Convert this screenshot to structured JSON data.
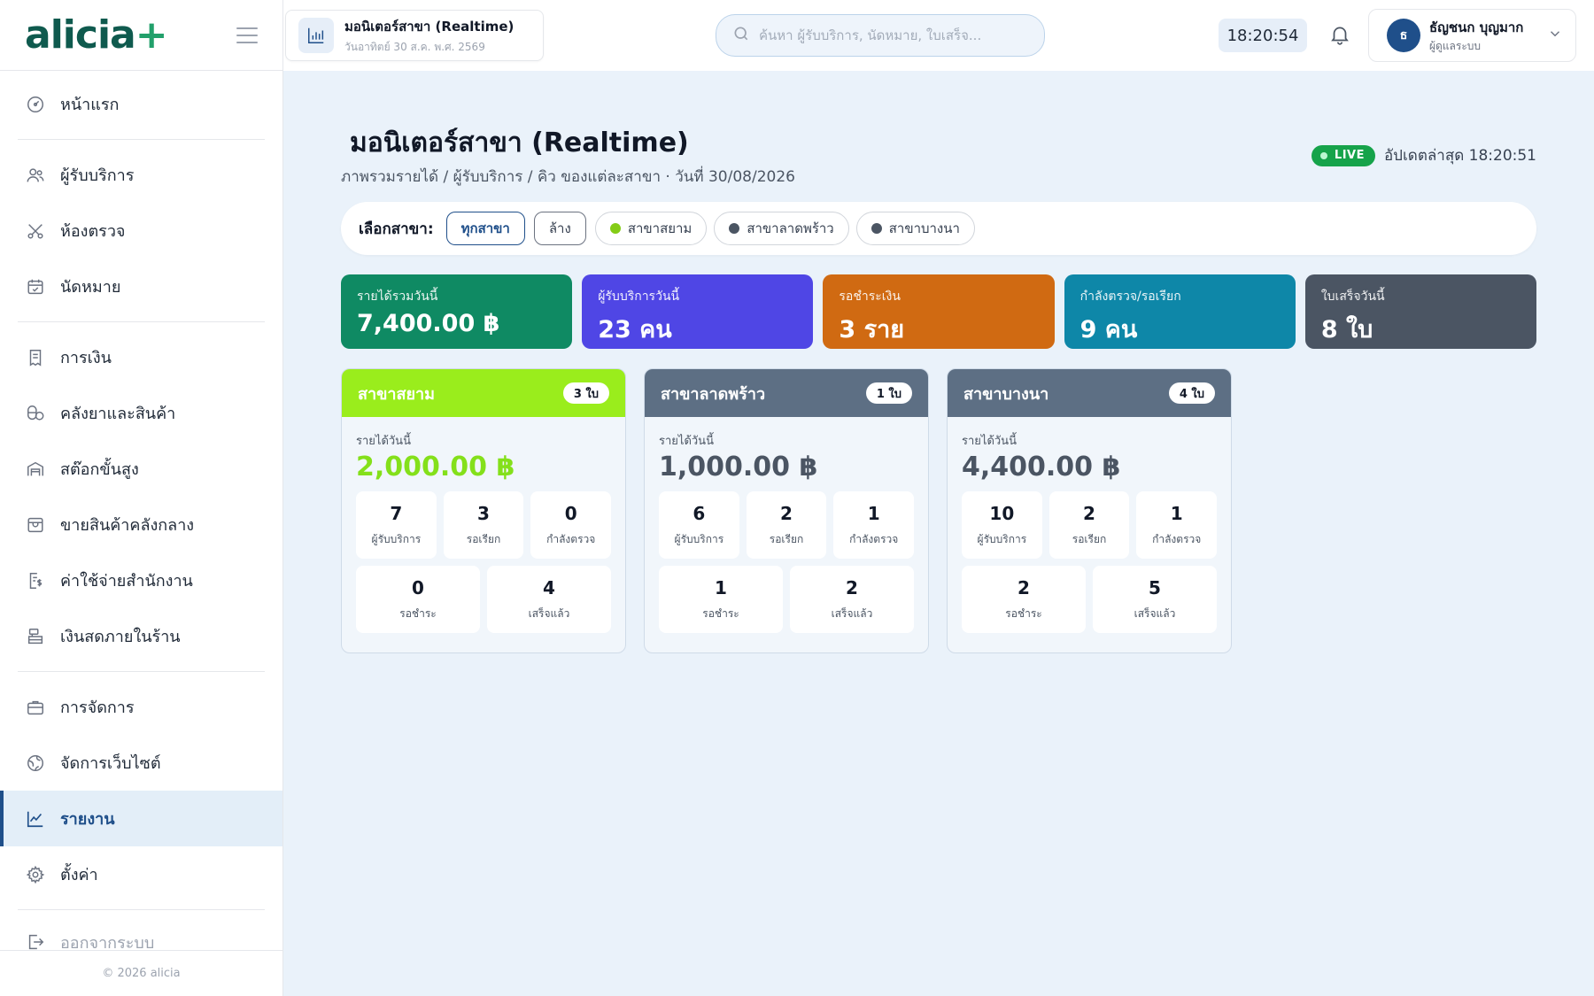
{
  "app": {
    "logo_main": "alicia",
    "logo_plus": "+"
  },
  "sidebar": {
    "items": [
      {
        "label": "หน้าแรก",
        "icon": "dashboard-icon"
      },
      {
        "label": "ผู้รับบริการ",
        "icon": "users-icon"
      },
      {
        "label": "ห้องตรวจ",
        "icon": "scissors-icon"
      },
      {
        "label": "นัดหมาย",
        "icon": "calendar-icon"
      },
      {
        "label": "การเงิน",
        "icon": "receipt-icon"
      },
      {
        "label": "คลังยาและสินค้า",
        "icon": "pills-icon"
      },
      {
        "label": "สต๊อกขั้นสูง",
        "icon": "warehouse-icon"
      },
      {
        "label": "ขายสินค้าคลังกลาง",
        "icon": "store-icon"
      },
      {
        "label": "ค่าใช้จ่ายสำนักงาน",
        "icon": "expense-icon"
      },
      {
        "label": "เงินสดภายในร้าน",
        "icon": "cash-register-icon"
      },
      {
        "label": "การจัดการ",
        "icon": "briefcase-icon"
      },
      {
        "label": "จัดการเว็บไซต์",
        "icon": "globe-icon"
      },
      {
        "label": "รายงาน",
        "icon": "chart-line-icon"
      },
      {
        "label": "ตั้งค่า",
        "icon": "gear-icon"
      },
      {
        "label": "ออกจากระบบ",
        "icon": "logout-icon"
      }
    ],
    "footer": "© 2026 alicia"
  },
  "topbar": {
    "page_title": "มอนิเตอร์สาขา (Realtime)",
    "page_date": "วันอาทิตย์ 30 ส.ค. พ.ศ. 2569",
    "search_placeholder": "ค้นหา ผู้รับบริการ, นัดหมาย, ใบเสร็จ...",
    "clock": "18:20:54",
    "user_initial": "ธ",
    "user_name": "ธัญชนก บุญมาก",
    "user_role": "ผู้ดูแลระบบ"
  },
  "main": {
    "title": "มอนิเตอร์สาขา (Realtime)",
    "subtitle": "ภาพรวมรายได้ / ผู้รับบริการ / คิว ของแต่ละสาขา · วันที่ 30/08/2026",
    "live_label": "LIVE",
    "updated": "อัปเดตล่าสุด 18:20:51"
  },
  "filter": {
    "label": "เลือกสาขา:",
    "all": "ทุกสาขา",
    "clear": "ล้าง",
    "branches": [
      {
        "label": "สาขาสยาม",
        "color": "#84cc16"
      },
      {
        "label": "สาขาลาดพร้าว",
        "color": "#4b5563"
      },
      {
        "label": "สาขาบางนา",
        "color": "#4b5563"
      }
    ]
  },
  "stats": [
    {
      "label": "รายได้รวมวันนี้",
      "value": "7,400.00 ฿",
      "color": "#0f8a63"
    },
    {
      "label": "ผู้รับบริการวันนี้",
      "value": "23 คน",
      "color": "#4f46e5"
    },
    {
      "label": "รอชำระเงิน",
      "value": "3 ราย",
      "color": "#d06a12"
    },
    {
      "label": "กำลังตรวจ/รอเรียก",
      "value": "9 คน",
      "color": "#0e87a8"
    },
    {
      "label": "ใบเสร็จวันนี้",
      "value": "8 ใบ",
      "color": "#4b5563"
    }
  ],
  "branch_cards": [
    {
      "name": "สาขาสยาม",
      "receipts": "3 ใบ",
      "head_color": "#9aed1c",
      "rev_color": "#84e01a",
      "rev_label": "รายได้วันนี้",
      "revenue": "2,000.00 ฿",
      "top": [
        {
          "num": "7",
          "label": "ผู้รับบริการ"
        },
        {
          "num": "3",
          "label": "รอเรียก"
        },
        {
          "num": "0",
          "label": "กำลังตรวจ"
        }
      ],
      "bottom": [
        {
          "num": "0",
          "label": "รอชำระ"
        },
        {
          "num": "4",
          "label": "เสร็จแล้ว"
        }
      ]
    },
    {
      "name": "สาขาลาดพร้าว",
      "receipts": "1 ใบ",
      "head_color": "#5d6f84",
      "rev_color": "#4b5563",
      "rev_label": "รายได้วันนี้",
      "revenue": "1,000.00 ฿",
      "top": [
        {
          "num": "6",
          "label": "ผู้รับบริการ"
        },
        {
          "num": "2",
          "label": "รอเรียก"
        },
        {
          "num": "1",
          "label": "กำลังตรวจ"
        }
      ],
      "bottom": [
        {
          "num": "1",
          "label": "รอชำระ"
        },
        {
          "num": "2",
          "label": "เสร็จแล้ว"
        }
      ]
    },
    {
      "name": "สาขาบางนา",
      "receipts": "4 ใบ",
      "head_color": "#5d6f84",
      "rev_color": "#4b5563",
      "rev_label": "รายได้วันนี้",
      "revenue": "4,400.00 ฿",
      "top": [
        {
          "num": "10",
          "label": "ผู้รับบริการ"
        },
        {
          "num": "2",
          "label": "รอเรียก"
        },
        {
          "num": "1",
          "label": "กำลังตรวจ"
        }
      ],
      "bottom": [
        {
          "num": "2",
          "label": "รอชำระ"
        },
        {
          "num": "5",
          "label": "เสร็จแล้ว"
        }
      ]
    }
  ]
}
